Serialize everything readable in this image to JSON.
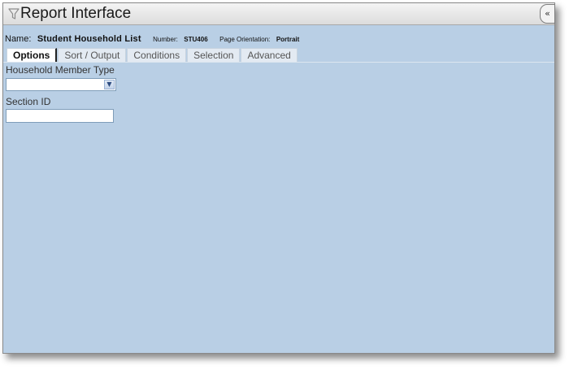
{
  "window": {
    "title": "Report Interface",
    "collapse_label": "«"
  },
  "report_info": {
    "name_label": "Name:",
    "name_value": "Student Household List",
    "number_label": "Number:",
    "number_value": "STU406",
    "orientation_label": "Page Orientation:",
    "orientation_value": "Portrait"
  },
  "tabs": [
    {
      "label": "Options",
      "active": true
    },
    {
      "label": "Sort / Output",
      "active": false
    },
    {
      "label": "Conditions",
      "active": false
    },
    {
      "label": "Selection",
      "active": false
    },
    {
      "label": "Advanced",
      "active": false
    }
  ],
  "options": {
    "household_member_type": {
      "label": "Household Member Type",
      "value": ""
    },
    "section_id": {
      "label": "Section ID",
      "value": "",
      "placeholder": ""
    }
  },
  "colors": {
    "panel_background": "#b9cfe5",
    "titlebar": "#e8e8e8",
    "active_tab": "#ffffff",
    "inactive_tab": "#e3eaf2"
  }
}
